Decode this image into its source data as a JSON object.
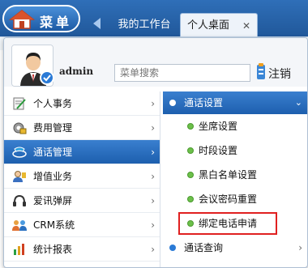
{
  "header": {
    "menu_label": "菜单",
    "tabs": [
      {
        "label": "我的工作台"
      },
      {
        "label": "个人桌面",
        "close": "✕"
      }
    ]
  },
  "user": {
    "name": "admin",
    "search_placeholder": "菜单搜索",
    "logout_label": "注销"
  },
  "left_menu": [
    {
      "label": "个人事务",
      "icon": "notepad-icon"
    },
    {
      "label": "费用管理",
      "icon": "money-settings-icon"
    },
    {
      "label": "通话管理",
      "icon": "phone-network-icon",
      "active": true
    },
    {
      "label": "增值业务",
      "icon": "user-plus-icon"
    },
    {
      "label": "爱讯弹屏",
      "icon": "headset-icon"
    },
    {
      "label": "CRM系统",
      "icon": "people-group-icon"
    },
    {
      "label": "统计报表",
      "icon": "bar-chart-icon"
    }
  ],
  "submenu": {
    "header": "通话设置",
    "items": [
      {
        "label": "坐席设置"
      },
      {
        "label": "时段设置"
      },
      {
        "label": "黑白名单设置"
      },
      {
        "label": "会议密码重置"
      },
      {
        "label": "绑定电话申请",
        "highlighted": true
      }
    ],
    "footer": "通话查询"
  },
  "colors": {
    "accent": "#1d5fae",
    "highlight_box": "#e02020",
    "dot_green": "#6cc04a"
  }
}
